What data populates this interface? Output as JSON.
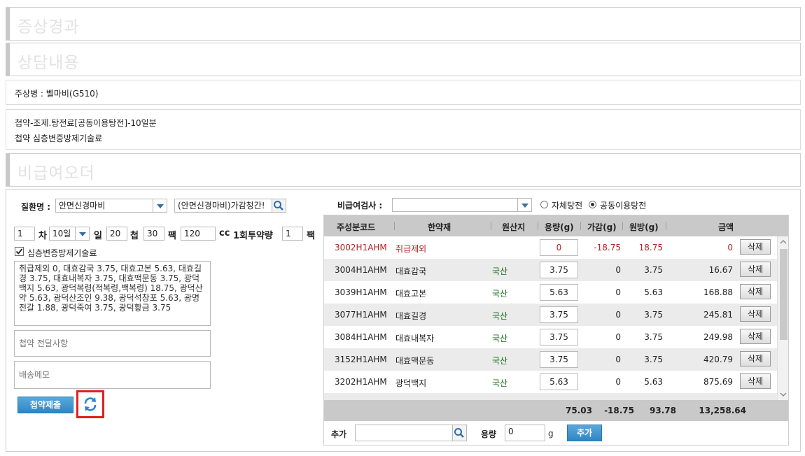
{
  "sections": {
    "symptom_title": "증상경과",
    "consult_title": "상담내용",
    "noncovered_title": "비급여오더"
  },
  "main_disease": "주상병 : 벨마비(G510)",
  "prescription_lines": [
    "첩약-조제.탕전료[공동이용탕전]-10일분",
    "첩약 심층변증방제기술료"
  ],
  "order": {
    "disease_label": "질환명 :",
    "disease_value": "안면신경마비",
    "formula_value": "(안면신경마비)가감청간!",
    "round": "1",
    "round_suffix": "차",
    "days_value": "10일",
    "days_suffix": "일",
    "cheop_value": "20",
    "cheop_suffix": "첩",
    "pack_value": "30",
    "pack_suffix": "팩",
    "cc_value": "120",
    "cc_suffix": "cc",
    "dose_label": "1회투약량",
    "dose_value": "1",
    "dose_suffix": "팩",
    "tech_fee_label": "심층변증방제기술료",
    "herb_summary": "취급제외 0, 대효감국 3.75, 대효고본 5.63, 대효길경 3.75, 대효내복자 3.75, 대효맥문동 3.75, 광덕백지 5.63, 광덕복령(적복령,백복령) 18.75, 광덕산약 5.63, 광덕산조인 9.38, 광덕석창포 5.63, 광명전갈 1.88, 광덕죽여 3.75, 광덕황금 3.75",
    "delivery_note_placeholder": "첩약 전달사항",
    "shipping_memo_placeholder": "배송메모",
    "submit_label": "첩약제출"
  },
  "inspector": {
    "label": "비급여검사 :",
    "value": "",
    "radio_self": "자체탕전",
    "radio_shared": "공동이용탕전",
    "selected": "공동이용탕전"
  },
  "grid": {
    "headers": [
      "주성분코드",
      "한약재",
      "원산지",
      "용량(g)",
      "가감(g)",
      "원방(g)",
      "금액"
    ],
    "delete_label": "삭제",
    "rows": [
      {
        "code": "3002H1AHM",
        "name": "취급제외",
        "origin": "",
        "qty": "0",
        "adj": "-18.75",
        "base": "18.75",
        "amount": "0",
        "excluded": true
      },
      {
        "code": "3004H1AHM",
        "name": "대효감국",
        "origin": "국산",
        "qty": "3.75",
        "adj": "0",
        "base": "3.75",
        "amount": "16.67",
        "excluded": false
      },
      {
        "code": "3039H1AHM",
        "name": "대효고본",
        "origin": "국산",
        "qty": "5.63",
        "adj": "0",
        "base": "5.63",
        "amount": "168.88",
        "excluded": false
      },
      {
        "code": "3077H1AHM",
        "name": "대효길경",
        "origin": "국산",
        "qty": "3.75",
        "adj": "0",
        "base": "3.75",
        "amount": "245.81",
        "excluded": false
      },
      {
        "code": "3084H1AHM",
        "name": "대효내복자",
        "origin": "국산",
        "qty": "3.75",
        "adj": "0",
        "base": "3.75",
        "amount": "249.98",
        "excluded": false
      },
      {
        "code": "3152H1AHM",
        "name": "대효맥문동",
        "origin": "국산",
        "qty": "3.75",
        "adj": "0",
        "base": "3.75",
        "amount": "420.79",
        "excluded": false
      },
      {
        "code": "3202H1AHM",
        "name": "광덕백지",
        "origin": "국산",
        "qty": "5.63",
        "adj": "0",
        "base": "5.63",
        "amount": "875.69",
        "excluded": false
      }
    ],
    "totals": {
      "qty": "75.03",
      "adj": "-18.75",
      "base": "93.78",
      "amount": "13,258.64"
    },
    "add_label": "추가",
    "add_qty_label": "용량",
    "add_qty_value": "0",
    "add_unit": "g",
    "add_button": "추가"
  },
  "colors": {
    "excluded_red": "#b22222",
    "origin_green": "#1a6b1a",
    "accent_blue": "#2f86c4",
    "highlight_red": "#e02020"
  }
}
